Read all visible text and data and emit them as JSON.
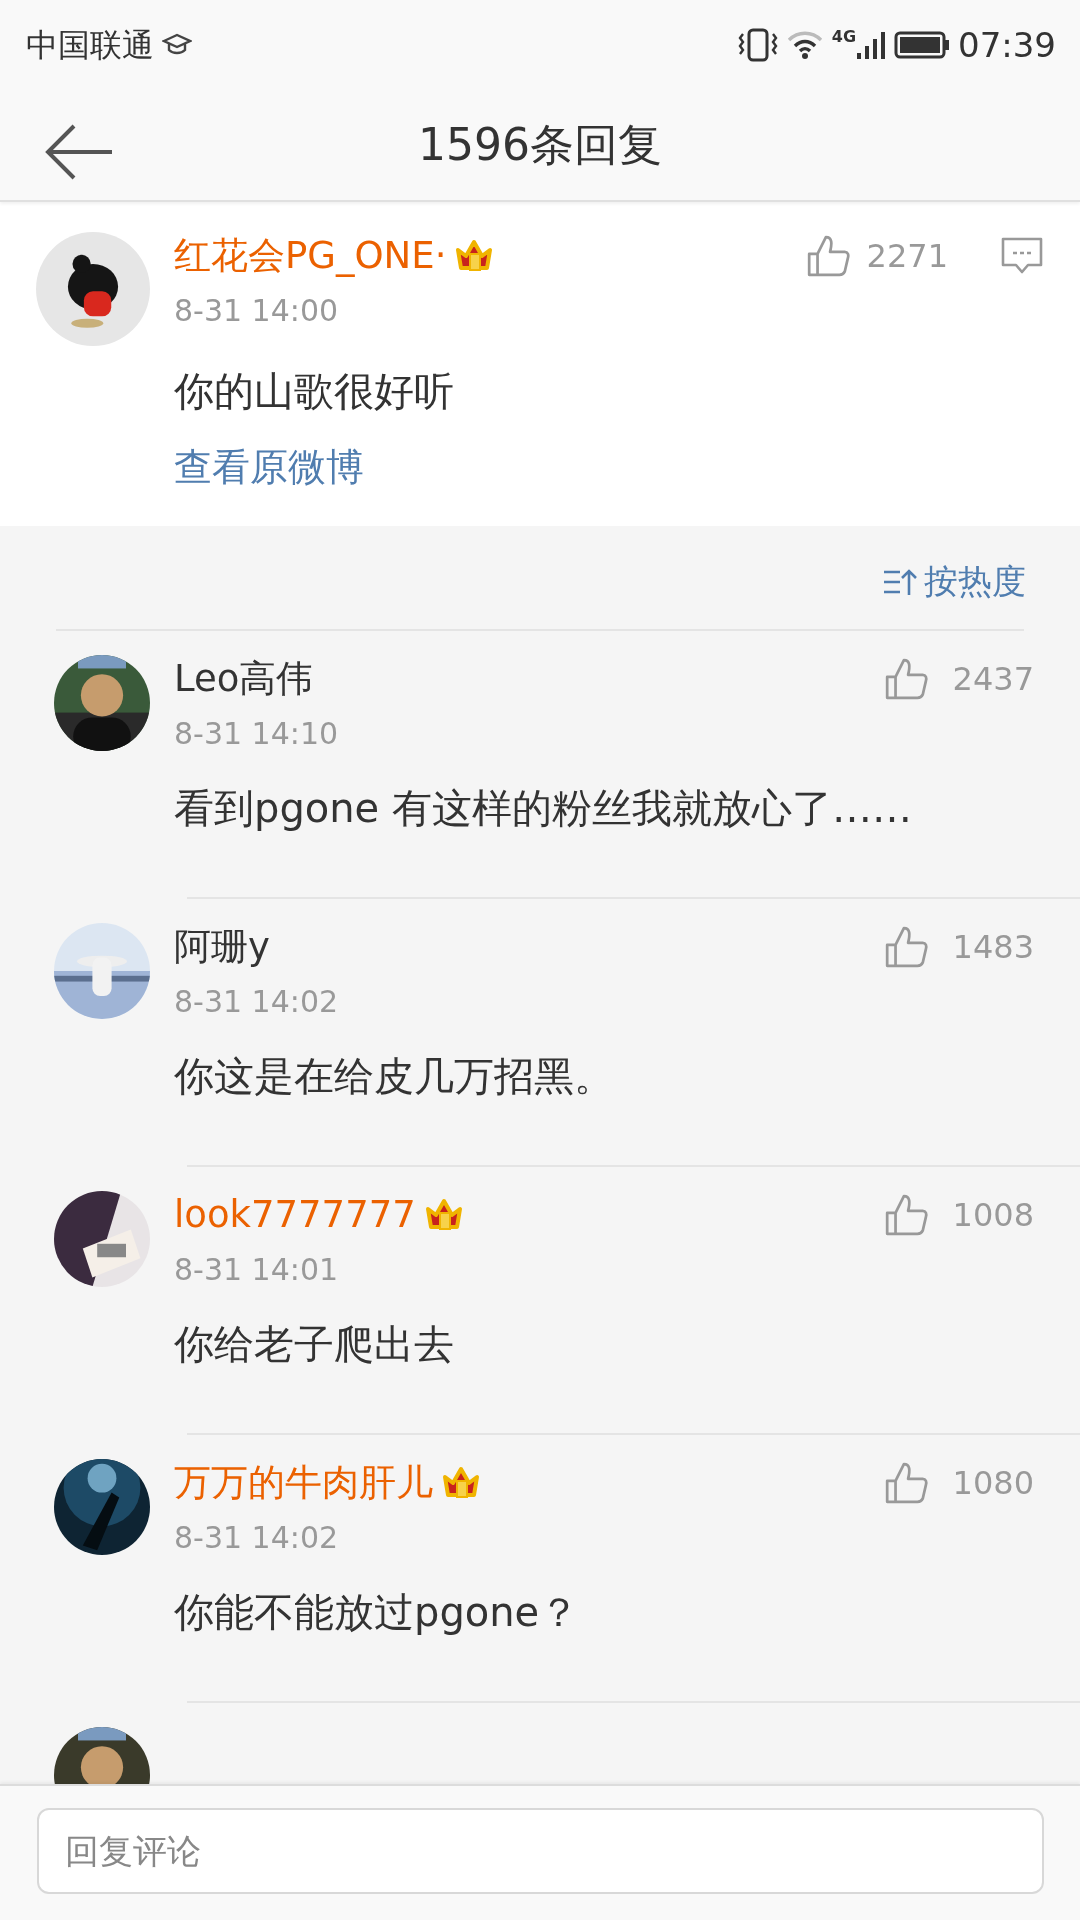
{
  "status_bar": {
    "carrier": "中国联通",
    "network": "4G",
    "time": "07:39"
  },
  "header": {
    "title": "1596条回复"
  },
  "main_comment": {
    "name": "红花会PG_ONE·",
    "vip": true,
    "time": "8-31 14:00",
    "text": "你的山歌很好听",
    "likes": "2271",
    "link": "查看原微博"
  },
  "sort": {
    "label": "按热度"
  },
  "replies": [
    {
      "name": "Leo高伟",
      "vip": false,
      "time": "8-31 14:10",
      "text": "看到pgone 有这样的粉丝我就放心了……",
      "likes": "2437"
    },
    {
      "name": "阿珊y",
      "vip": false,
      "time": "8-31 14:02",
      "text": "你这是在给皮几万招黑。",
      "likes": "1483"
    },
    {
      "name": "look7777777",
      "vip": true,
      "time": "8-31 14:01",
      "text": "你给老子爬出去",
      "likes": "1008"
    },
    {
      "name": "万万的牛肉肝儿",
      "vip": true,
      "time": "8-31 14:02",
      "text": "你能不能放过pgone？",
      "likes": "1080"
    }
  ],
  "reply_box": {
    "placeholder": "回复评论"
  }
}
